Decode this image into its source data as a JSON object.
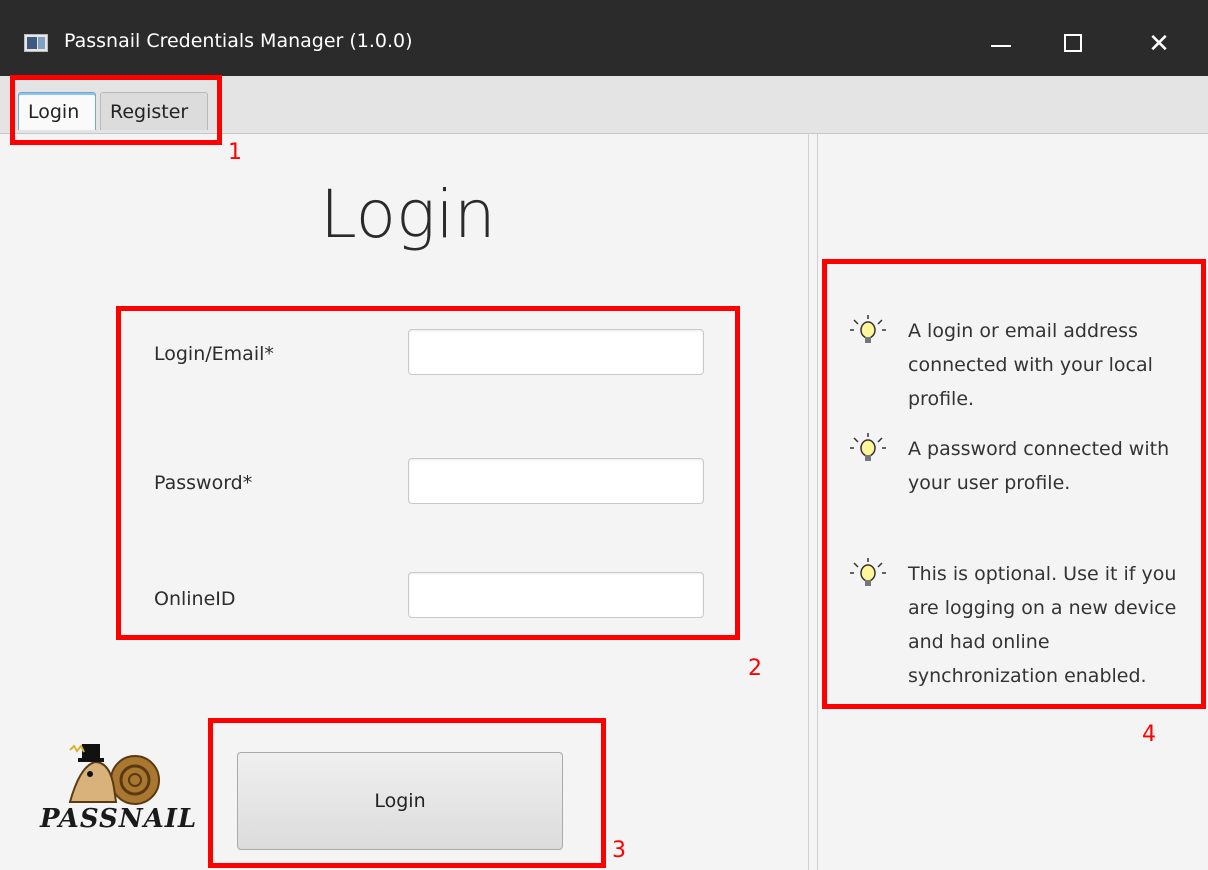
{
  "window": {
    "title": "Passnail Credentials Manager (1.0.0)"
  },
  "tabs": [
    {
      "label": "Login"
    },
    {
      "label": "Register"
    }
  ],
  "form": {
    "title": "Login",
    "fields": [
      {
        "label": "Login/Email*",
        "value": ""
      },
      {
        "label": "Password*",
        "value": ""
      },
      {
        "label": "OnlineID",
        "value": ""
      }
    ],
    "submit_label": "Login"
  },
  "logo": {
    "text": "PASSNAIL"
  },
  "hints": [
    {
      "icon": "lightbulb-icon",
      "text": "A login or email address connected with your local profile."
    },
    {
      "icon": "lightbulb-icon",
      "text": "A password connected with your user profile."
    },
    {
      "icon": "lightbulb-icon",
      "text": "This is optional. Use it if you are logging on a new device and had online synchronization enabled."
    }
  ],
  "annotations": [
    "1",
    "2",
    "3",
    "4"
  ],
  "colors": {
    "annotation": "#ff0000",
    "titlebar": "#2b2b2b"
  }
}
